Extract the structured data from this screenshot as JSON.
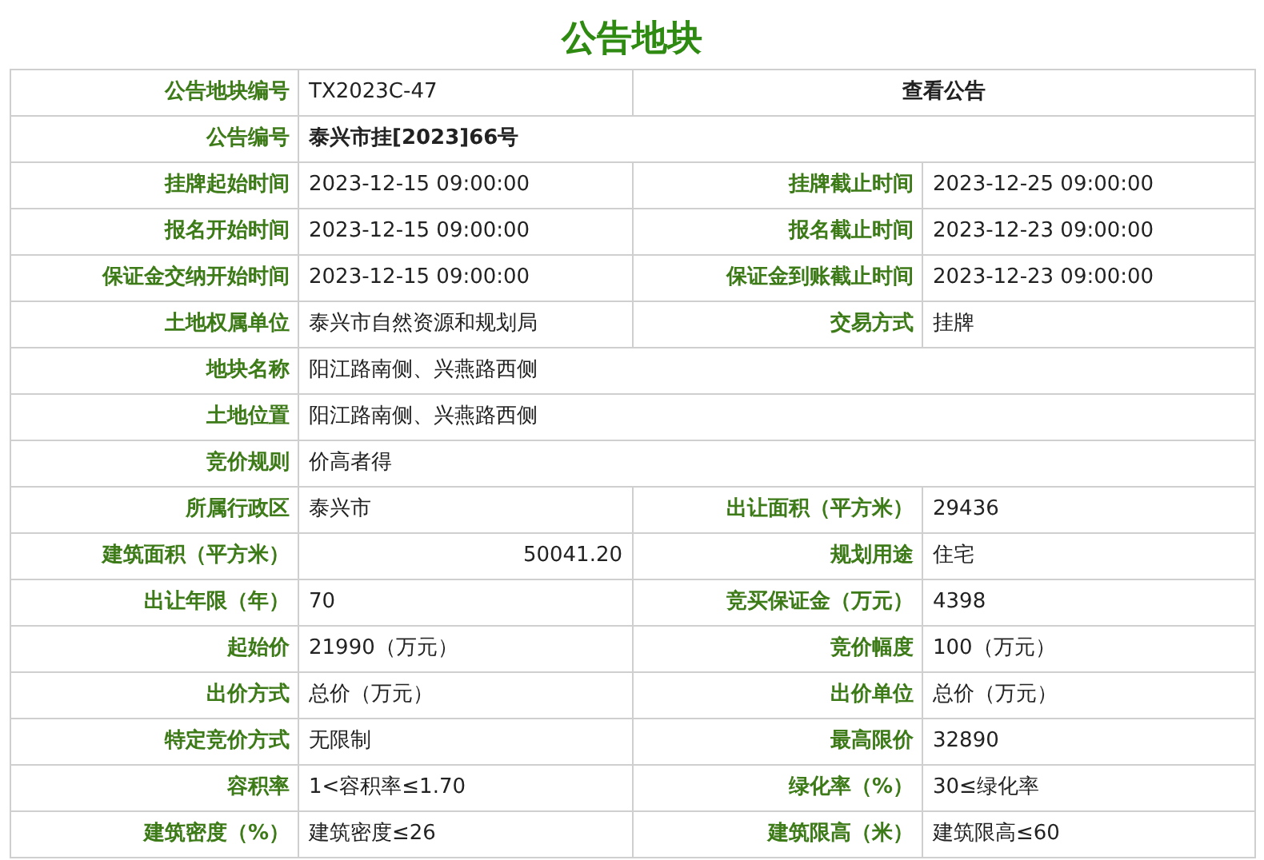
{
  "title": "公告地块",
  "rows": [
    {
      "kind": "link",
      "label": "公告地块编号",
      "value": "TX2023C-47",
      "link": "查看公告"
    },
    {
      "kind": "wide_bold",
      "label": "公告编号",
      "value": "泰兴市挂[2023]66号"
    },
    {
      "kind": "pair",
      "label": "挂牌起始时间",
      "value": "2023-12-15 09:00:00",
      "label_2": "挂牌截止时间",
      "value_2": "2023-12-25 09:00:00"
    },
    {
      "kind": "pair",
      "label": "报名开始时间",
      "value": "2023-12-15 09:00:00",
      "label_2": "报名截止时间",
      "value_2": "2023-12-23 09:00:00"
    },
    {
      "kind": "pair",
      "label": "保证金交纳开始时间",
      "value": "2023-12-15 09:00:00",
      "label_2": "保证金到账截止时间",
      "value_2": "2023-12-23 09:00:00"
    },
    {
      "kind": "pair",
      "label": "土地权属单位",
      "value": "泰兴市自然资源和规划局",
      "label_2": "交易方式",
      "value_2": "挂牌"
    },
    {
      "kind": "wide",
      "label": "地块名称",
      "value": "阳江路南侧、兴燕路西侧"
    },
    {
      "kind": "wide",
      "label": "土地位置",
      "value": "阳江路南侧、兴燕路西侧"
    },
    {
      "kind": "wide",
      "label": "竞价规则",
      "value": "价高者得"
    },
    {
      "kind": "pair",
      "label": "所属行政区",
      "value": "泰兴市",
      "label_2": "出让面积（平方米）",
      "value_2": "29436"
    },
    {
      "kind": "pair_right",
      "label": "建筑面积（平方米）",
      "value": "50041.20",
      "label_2": "规划用途",
      "value_2": "住宅"
    },
    {
      "kind": "pair",
      "label": "出让年限（年）",
      "value": "70",
      "label_2": "竞买保证金（万元）",
      "value_2": "4398"
    },
    {
      "kind": "pair",
      "label": "起始价",
      "value": "21990（万元）",
      "label_2": "竞价幅度",
      "value_2": "100（万元）"
    },
    {
      "kind": "pair",
      "label": "出价方式",
      "value": "总价（万元）",
      "label_2": "出价单位",
      "value_2": "总价（万元）"
    },
    {
      "kind": "pair",
      "label": "特定竞价方式",
      "value": "无限制",
      "label_2": "最高限价",
      "value_2": "32890"
    },
    {
      "kind": "pair",
      "label": "容积率",
      "value": "1<容积率≤1.70",
      "label_2": "绿化率（%）",
      "value_2": "30≤绿化率"
    },
    {
      "kind": "pair",
      "label": "建筑密度（%）",
      "value": "建筑密度≤26",
      "label_2": "建筑限高（米）",
      "value_2": "建筑限高≤60"
    }
  ]
}
